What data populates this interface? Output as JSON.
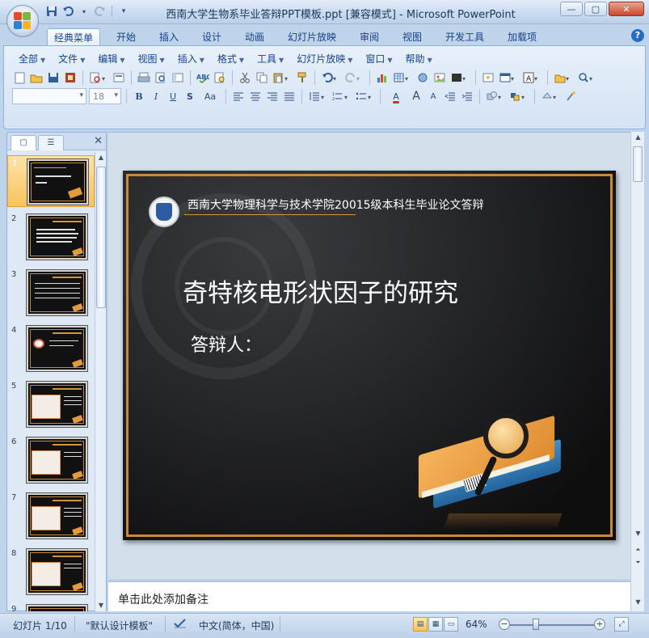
{
  "window": {
    "title": "西南大学生物系毕业答辩PPT模板.ppt [兼容模式] - Microsoft PowerPoint",
    "controls": {
      "minimize": "—",
      "maximize": "▢",
      "close": "✕"
    }
  },
  "qat": {
    "save_icon": "save-icon",
    "undo_icon": "undo-icon",
    "redo_icon": "redo-icon",
    "customize_icon": "chevron-down-icon"
  },
  "ribbon_tabs": [
    "经典菜单",
    "开始",
    "插入",
    "设计",
    "动画",
    "幻灯片放映",
    "审阅",
    "视图",
    "开发工具",
    "加载项"
  ],
  "help_label": "?",
  "menubar": [
    "全部",
    "文件",
    "编辑",
    "视图",
    "插入",
    "格式",
    "工具",
    "幻灯片放映",
    "窗口",
    "帮助"
  ],
  "toolbar": {
    "font_name_value": "",
    "font_size_value": "18",
    "bold": "B",
    "italic": "I",
    "underline": "U",
    "strike": "S",
    "case": "Aa",
    "text_color": "A",
    "grow": "A",
    "shrink": "A",
    "text_box": "A"
  },
  "left_pane": {
    "tabs": [
      "slides-tab-icon",
      "outline-tab-icon"
    ],
    "close_label": "✕",
    "thumbnails": [
      {
        "num": "1",
        "kind": "title"
      },
      {
        "num": "2",
        "kind": "text"
      },
      {
        "num": "3",
        "kind": "table"
      },
      {
        "num": "4",
        "kind": "diagram"
      },
      {
        "num": "5",
        "kind": "chart"
      },
      {
        "num": "6",
        "kind": "chart"
      },
      {
        "num": "7",
        "kind": "chart"
      },
      {
        "num": "8",
        "kind": "chart"
      },
      {
        "num": "9",
        "kind": "chart"
      }
    ],
    "selected_index": 0
  },
  "slide": {
    "header": "西南大学物理科学与技术学院20015级本科生毕业论文答辩",
    "title": "奇特核电形状因子的研究",
    "presenter": "答辩人：",
    "accent_color": "#c8893b",
    "background_color": "#1a1a1b"
  },
  "notes": {
    "placeholder": "单击此处添加备注"
  },
  "status": {
    "slide_counter": "幻灯片 1/10",
    "theme": "\"默认设计模板\"",
    "language": "中文(简体，中国)",
    "zoom": "64%",
    "zoom_level": 0.64
  }
}
